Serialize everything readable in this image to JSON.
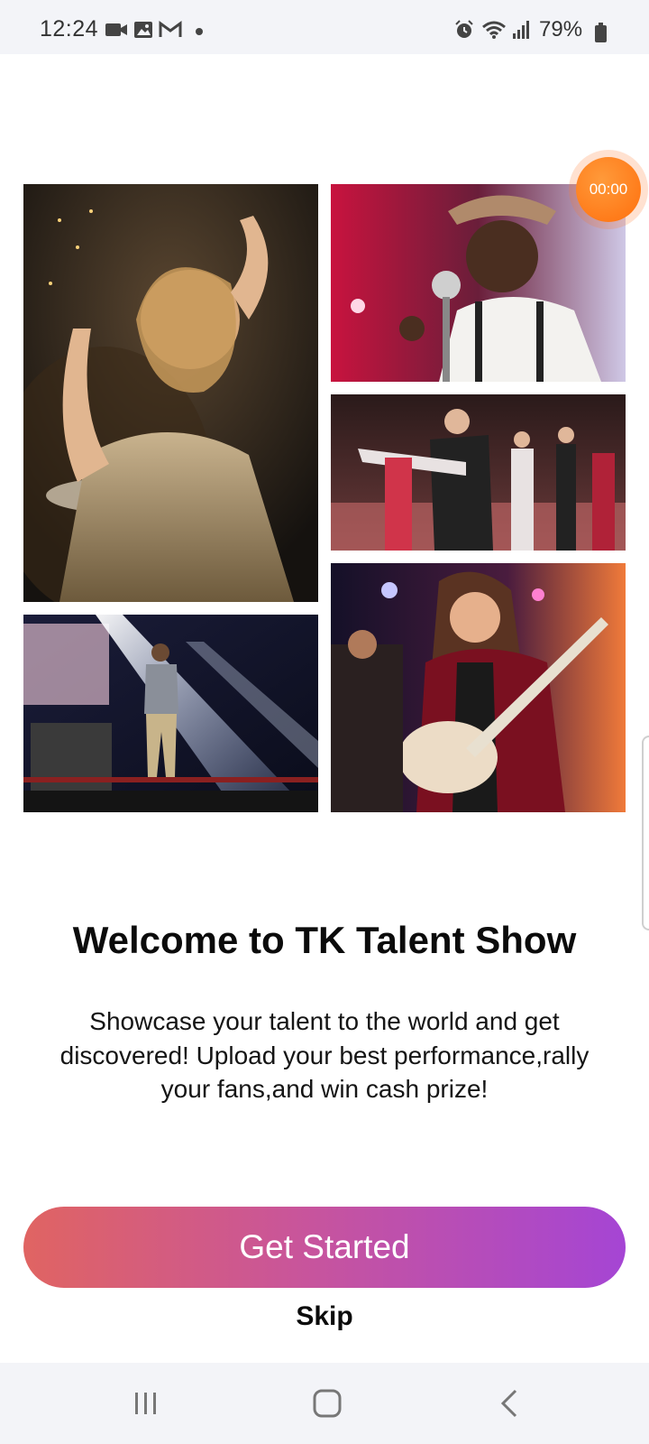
{
  "status_bar": {
    "time": "12:24",
    "battery": "79%",
    "icons": [
      "video-icon",
      "gallery-icon",
      "gmail-icon",
      "dot-icon",
      "alarm-icon",
      "wifi-icon",
      "signal-icon",
      "battery-icon"
    ]
  },
  "timer": {
    "label": "00:00",
    "color": "#ff7a1a"
  },
  "gallery": {
    "photos": [
      {
        "name": "dancing-woman-photo"
      },
      {
        "name": "singer-with-hat-photo"
      },
      {
        "name": "ballroom-dancers-photo"
      },
      {
        "name": "stage-performer-photo"
      },
      {
        "name": "guitarist-photo"
      }
    ]
  },
  "welcome": {
    "title": "Welcome to TK Talent Show",
    "description": "Showcase your talent to the world and get discovered! Upload your best performance,rally your fans,and win cash prize!"
  },
  "actions": {
    "get_started": "Get Started",
    "skip": "Skip",
    "gradient_start": "#e06462",
    "gradient_end": "#a545d4"
  },
  "nav_bar": {
    "icons": [
      "recent-apps-icon",
      "home-icon",
      "back-icon"
    ]
  }
}
